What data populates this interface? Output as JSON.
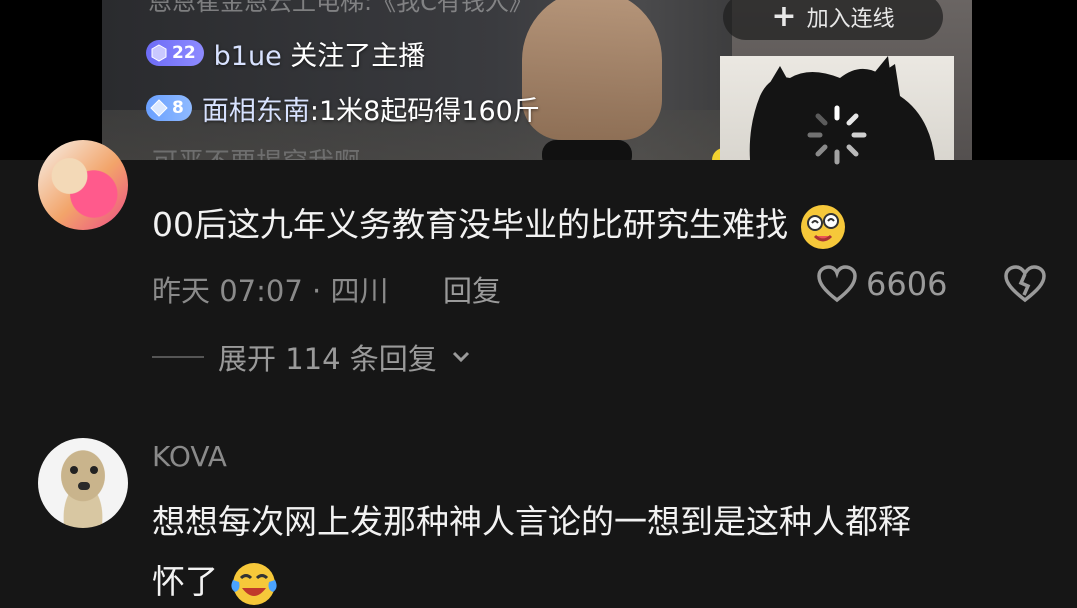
{
  "live": {
    "previous_line": "恩恩崔金恩云上电梯:《我C有钱人》",
    "messages": [
      {
        "level": "22",
        "user": "b1ue",
        "text": " 关注了主播"
      },
      {
        "level": "8",
        "user": "面相东南",
        "text": ":1米8起码得160斤"
      }
    ],
    "join_button": "加入连线"
  },
  "comments": [
    {
      "username": "可恶不要揭穿我啊",
      "text": "00后这九年义务教育没毕业的比研究生难找",
      "meta": "昨天 07:07 · 四川",
      "reply_label": "回复",
      "likes": "6606",
      "expand_label": "展开 114 条回复"
    },
    {
      "username": "KOVA",
      "text_line1": "想想每次网上发那种神人言论的一想到是这种人都释",
      "text_line2": "怀了"
    }
  ],
  "colors": {
    "background": "#161616",
    "level_purple": "#7c7bf8",
    "level_blue": "#78aaff"
  }
}
